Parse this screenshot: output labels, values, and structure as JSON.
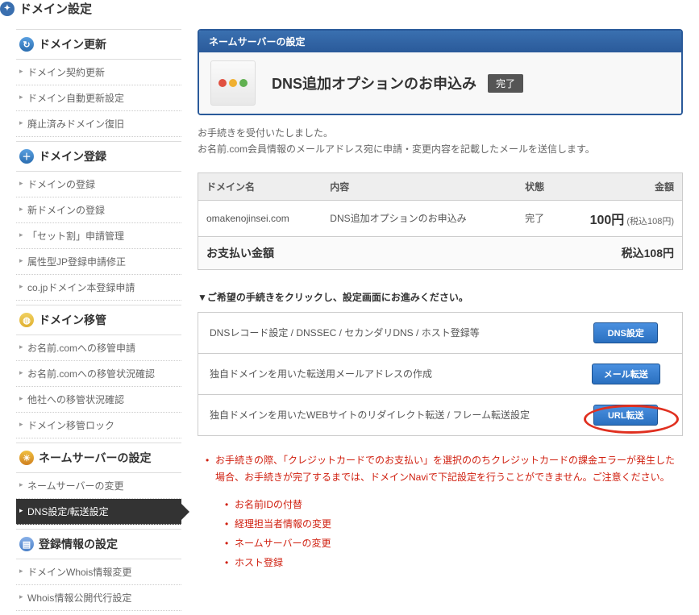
{
  "page_title": "ドメイン設定",
  "sidebar": [
    {
      "title": "ドメイン更新",
      "icon": "refresh",
      "items": [
        "ドメイン契約更新",
        "ドメイン自動更新設定",
        "廃止済みドメイン復旧"
      ]
    },
    {
      "title": "ドメイン登録",
      "icon": "plus",
      "items": [
        "ドメインの登録",
        "新ドメインの登録",
        "「セット割」申請管理",
        "属性型JP登録申請修正",
        "co.jpドメイン本登録申請"
      ]
    },
    {
      "title": "ドメイン移管",
      "icon": "globe",
      "items": [
        "お名前.comへの移管申請",
        "お名前.comへの移管状況確認",
        "他社への移管状況確認",
        "ドメイン移管ロック"
      ]
    },
    {
      "title": "ネームサーバーの設定",
      "icon": "ns",
      "items": [
        "ネームサーバーの変更",
        "DNS設定/転送設定"
      ],
      "active_index": 1
    },
    {
      "title": "登録情報の設定",
      "icon": "doc",
      "items": [
        "ドメインWhois情報変更",
        "Whois情報公開代行設定"
      ]
    }
  ],
  "banner": {
    "header": "ネームサーバーの設定",
    "title": "DNS追加オプションのお申込み",
    "badge": "完了"
  },
  "messages": [
    "お手続きを受付いたしました。",
    "お名前.com会員情報のメールアドレス宛に申請・変更内容を記載したメールを送信します。"
  ],
  "result": {
    "headers": {
      "domain": "ドメイン名",
      "content": "内容",
      "status": "状態",
      "amount": "金額"
    },
    "row": {
      "domain": "omakenojinsei.com",
      "content": "DNS追加オプションのお申込み",
      "status": "完了",
      "price": "100円",
      "price_note": "(税込108円)"
    },
    "total_label": "お支払い金額",
    "total_value": "税込108円"
  },
  "instruction": "▼ご希望の手続きをクリックし、設定画面にお進みください。",
  "actions": [
    {
      "label": "DNSレコード設定 / DNSSEC / セカンダリDNS / ホスト登録等",
      "button": "DNS設定",
      "circled": false
    },
    {
      "label": "独自ドメインを用いた転送用メールアドレスの作成",
      "button": "メール転送",
      "circled": false
    },
    {
      "label": "独自ドメインを用いたWEBサイトのリダイレクト転送 / フレーム転送設定",
      "button": "URL転送",
      "circled": true
    }
  ],
  "notes": {
    "lead": "お手続きの際、「クレジットカードでのお支払い」を選択ののちクレジットカードの課金エラーが発生した場合、お手続きが完了するまでは、ドメインNaviで下記設定を行うことができません。ご注意ください。",
    "items": [
      "お名前IDの付替",
      "経理担当者情報の変更",
      "ネームサーバーの変更",
      "ホスト登録"
    ]
  }
}
